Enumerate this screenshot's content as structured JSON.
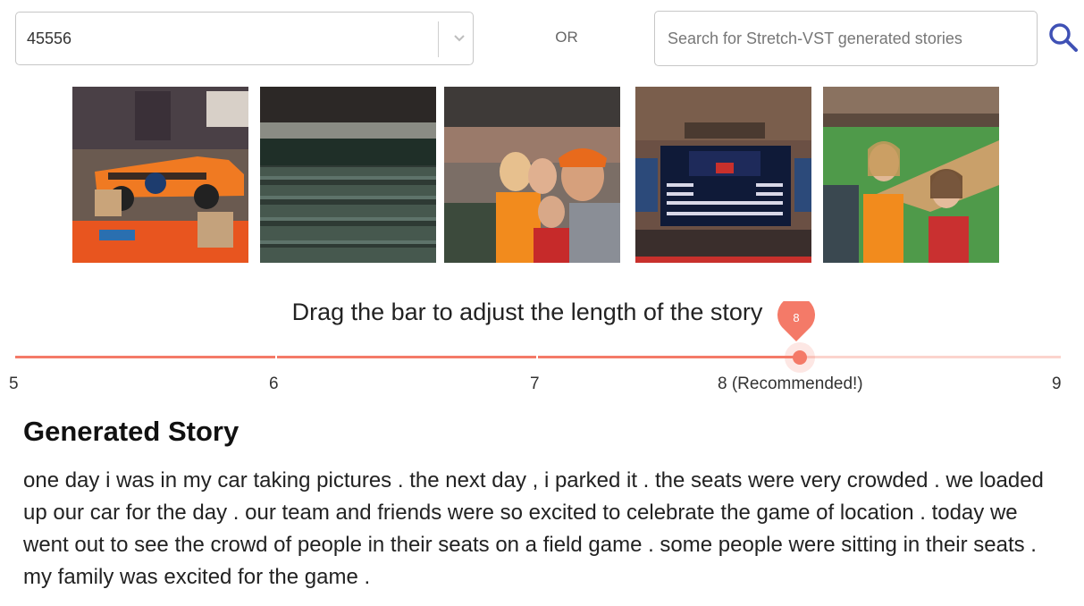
{
  "album_select": {
    "value": "45556"
  },
  "or_label": "OR",
  "search": {
    "placeholder": "Search for Stretch-VST generated stories"
  },
  "accent_color": "#f47a68",
  "slider": {
    "title": "Drag the bar to adjust the length of the story",
    "min": 5,
    "max": 9,
    "value": 8,
    "value_label": "8",
    "marks": [
      "5",
      "6",
      "7",
      "8 (Recommended!)",
      "9"
    ]
  },
  "story": {
    "heading": "Generated Story",
    "text": "one day i was in my car taking pictures . the next day , i parked it . the seats were very crowded . we loaded up our car for the day . our team and friends were so excited to celebrate the game of location . today we went out to see the crowd of people in their seats on a field game . some people were sitting in their seats . my family was excited for the game ."
  }
}
